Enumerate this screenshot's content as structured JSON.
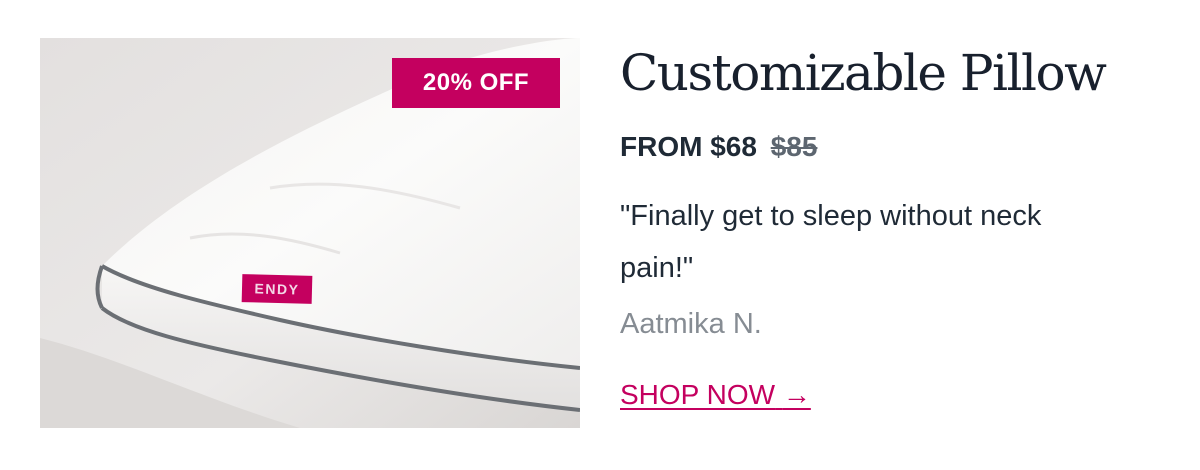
{
  "product": {
    "badge": "20% OFF",
    "brand_tag": "ENDY",
    "title": "Customizable Pillow",
    "price_prefix": "FROM",
    "price_current": "$68",
    "price_original": "$85",
    "review_quote": "\"Finally get to sleep without neck pain!\"",
    "reviewer": "Aatmika N.",
    "cta_label": "SHOP NOW",
    "cta_arrow": "→"
  },
  "colors": {
    "accent": "#c4005f",
    "heading": "#18202d",
    "muted": "#868c93",
    "piping": "#6b6f74"
  },
  "icons": {
    "cta_arrow": "arrow-right-icon"
  }
}
